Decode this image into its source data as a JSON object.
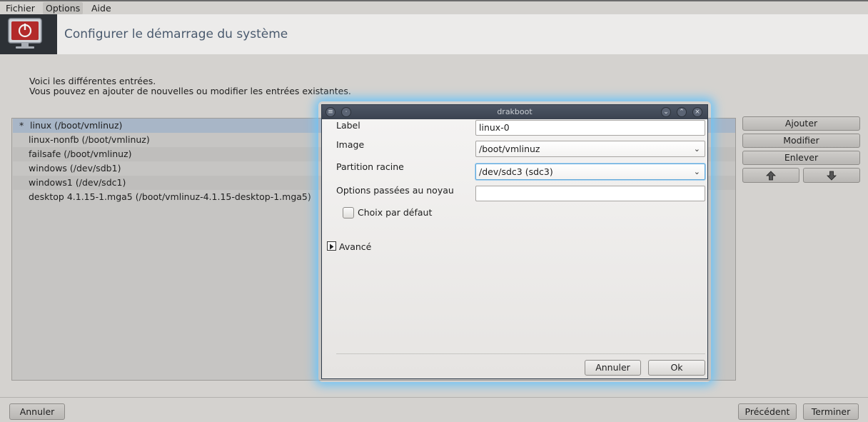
{
  "menu": {
    "items": [
      {
        "label": "Fichier"
      },
      {
        "label": "Options"
      },
      {
        "label": "Aide"
      }
    ]
  },
  "header": {
    "title": "Configurer le démarrage du système",
    "icon": "power-icon"
  },
  "intro": {
    "line1": "Voici les différentes entrées.",
    "line2": "Vous pouvez en ajouter de nouvelles ou modifier les entrées existantes."
  },
  "entries": [
    {
      "marker": "*",
      "label": "linux (/boot/vmlinuz)"
    },
    {
      "marker": "",
      "label": "linux-nonfb (/boot/vmlinuz)"
    },
    {
      "marker": "",
      "label": "failsafe (/boot/vmlinuz)"
    },
    {
      "marker": "",
      "label": "windows (/dev/sdb1)"
    },
    {
      "marker": "",
      "label": "windows1 (/dev/sdc1)"
    },
    {
      "marker": "",
      "label": "desktop 4.1.15-1.mga5 (/boot/vmlinuz-4.1.15-desktop-1.mga5)"
    }
  ],
  "side_buttons": {
    "add": "Ajouter",
    "modify": "Modifier",
    "remove": "Enlever",
    "up_icon": "arrow-up-icon",
    "down_icon": "arrow-down-icon"
  },
  "footer": {
    "cancel": "Annuler",
    "previous": "Précédent",
    "finish": "Terminer"
  },
  "dialog": {
    "title": "drakboot",
    "fields": {
      "label_label": "Label",
      "label_value": "linux-0",
      "image_label": "Image",
      "image_value": "/boot/vmlinuz",
      "root_label": "Partition racine",
      "root_value": "/dev/sdc3 (sdc3)",
      "kernel_opts_label": "Options passées au noyau",
      "kernel_opts_value": ""
    },
    "default_checkbox": "Choix par défaut",
    "advanced": "Avancé",
    "cancel": "Annuler",
    "ok": "Ok"
  },
  "colors": {
    "accent": "#6fc3f5",
    "selection": "#a8b6c7",
    "title_text": "#4a5a6e"
  }
}
